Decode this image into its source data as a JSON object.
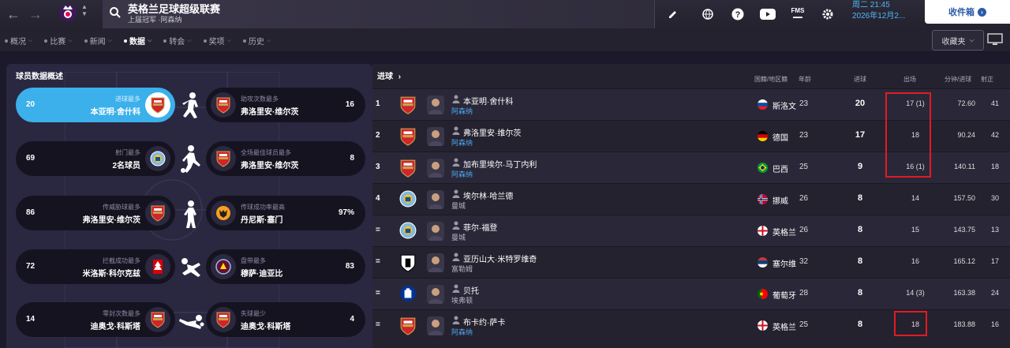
{
  "header": {
    "competition_title": "英格兰足球超级联赛",
    "competition_sub": "上届冠军 ·阿森纳",
    "date_line1": "周二 21:45",
    "date_line2": "2026年12月2...",
    "inbox_label": "收件箱",
    "fms_label": "FMS"
  },
  "tabs": [
    {
      "label": "概况",
      "active": false,
      "dropdown": true
    },
    {
      "label": "比赛",
      "active": false,
      "dropdown": true
    },
    {
      "label": "新闻",
      "active": false,
      "dropdown": true
    },
    {
      "label": "数据",
      "active": true,
      "dropdown": true
    },
    {
      "label": "转会",
      "active": false,
      "dropdown": true
    },
    {
      "label": "奖项",
      "active": false,
      "dropdown": true
    },
    {
      "label": "历史",
      "active": false,
      "dropdown": true
    }
  ],
  "favorites_label": "收藏夹",
  "overview": {
    "title": "球员数据概述",
    "cards": [
      {
        "label": "进球最多",
        "player": "本亚明·舍什科",
        "value": "20",
        "crest": "arsenal",
        "highlight": true
      },
      {
        "label": "助攻次数最多",
        "player": "弗洛里安·维尔茨",
        "value": "16",
        "crest": "arsenal"
      },
      {
        "label": "射门最多",
        "player": "2名球员",
        "value": "69",
        "crest": "mancity"
      },
      {
        "label": "全场最佳球员最多",
        "player": "弗洛里安·维尔茨",
        "value": "8",
        "crest": "arsenal"
      },
      {
        "label": "传威胁球最多",
        "player": "弗洛里安·维尔茨",
        "value": "86",
        "crest": "arsenal"
      },
      {
        "label": "传球成功率最高",
        "player": "丹尼斯·塞门",
        "value": "97%",
        "crest": "wolves"
      },
      {
        "label": "拦截成功最多",
        "player": "米洛斯·科尔克兹",
        "value": "72",
        "crest": "forest"
      },
      {
        "label": "盘带最多",
        "player": "穆萨·迪亚比",
        "value": "83",
        "crest": "villa"
      },
      {
        "label": "零封次数最多",
        "player": "迪奥戈·科斯塔",
        "value": "14",
        "crest": "arsenal"
      },
      {
        "label": "失球最少",
        "player": "迪奥戈·科斯塔",
        "value": "4",
        "crest": "arsenal"
      }
    ]
  },
  "scorers": {
    "title": "进球",
    "headers": {
      "nation": "国籍/地区籍",
      "age": "年龄",
      "goals": "进球",
      "apps": "出场",
      "mpg": "分钟/进球",
      "shots": "射正"
    },
    "rows": [
      {
        "rank": "1",
        "name": "本亚明·舍什科",
        "club": "阿森纳",
        "club_crest": "arsenal",
        "club_link": true,
        "nation": "斯洛文",
        "flag": "svn",
        "age": "23",
        "goals": "20",
        "apps": "17 (1)",
        "mpg": "72.60",
        "shots": "41"
      },
      {
        "rank": "2",
        "name": "弗洛里安·维尔茨",
        "club": "阿森纳",
        "club_crest": "arsenal",
        "club_link": true,
        "nation": "德国",
        "flag": "ger",
        "age": "23",
        "goals": "17",
        "apps": "18",
        "mpg": "90.24",
        "shots": "42"
      },
      {
        "rank": "3",
        "name": "加布里埃尔·马丁内利",
        "club": "阿森纳",
        "club_crest": "arsenal",
        "club_link": true,
        "nation": "巴西",
        "flag": "bra",
        "age": "25",
        "goals": "9",
        "apps": "16 (1)",
        "mpg": "140.11",
        "shots": "18"
      },
      {
        "rank": "4",
        "name": "埃尔林·哈兰德",
        "club": "曼城",
        "club_crest": "mancity",
        "club_link": false,
        "nation": "挪威",
        "flag": "nor",
        "age": "26",
        "goals": "8",
        "apps": "14",
        "mpg": "157.50",
        "shots": "30"
      },
      {
        "rank": "=",
        "name": "菲尔·福登",
        "club": "曼城",
        "club_crest": "mancity",
        "club_link": false,
        "nation": "英格兰",
        "flag": "eng",
        "age": "26",
        "goals": "8",
        "apps": "15",
        "mpg": "143.75",
        "shots": "13"
      },
      {
        "rank": "=",
        "name": "亚历山大·米特罗维奇",
        "club": "富勒姆",
        "club_crest": "fulham",
        "club_link": false,
        "nation": "塞尔维",
        "flag": "srb",
        "age": "32",
        "goals": "8",
        "apps": "16",
        "mpg": "165.12",
        "shots": "17"
      },
      {
        "rank": "=",
        "name": "贝托",
        "club": "埃弗顿",
        "club_crest": "everton",
        "club_link": false,
        "nation": "葡萄牙",
        "flag": "por",
        "age": "28",
        "goals": "8",
        "apps": "14 (3)",
        "mpg": "163.38",
        "shots": "24"
      },
      {
        "rank": "=",
        "name": "布卡约·萨卡",
        "club": "阿森纳",
        "club_crest": "arsenal",
        "club_link": true,
        "nation": "英格兰",
        "flag": "eng",
        "age": "25",
        "goals": "8",
        "apps": "18",
        "mpg": "183.88",
        "shots": "16"
      }
    ]
  },
  "colors": {
    "accent": "#3bb0ea",
    "link": "#4fa8f0",
    "arsenal_red": "#d1242c",
    "mancity_blue": "#7fb8e2",
    "highlight_box": "#e01b24"
  }
}
